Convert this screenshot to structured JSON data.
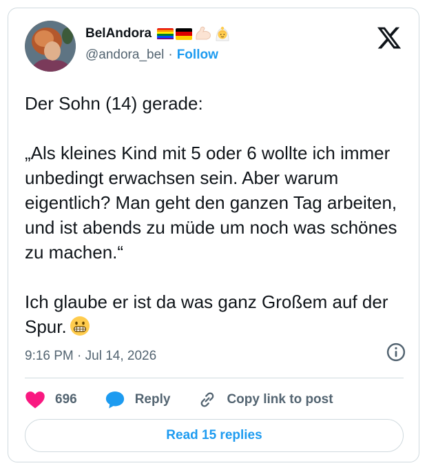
{
  "author": {
    "display_name": "BelAndora",
    "handle": "@andora_bel",
    "follow_label": "Follow",
    "separator": "·",
    "badges": [
      "rainbow-flag",
      "germany-flag",
      "flexed-biceps",
      "person-with-veil"
    ]
  },
  "tweet": {
    "paragraphs": [
      "Der Sohn (14) gerade:",
      "„Als kleines Kind mit 5 oder 6 wollte ich immer unbedingt erwachsen sein. Aber warum eigentlich? Man geht den ganzen Tag arbeiten, und ist abends zu müde um noch was schönes zu machen.“",
      "Ich glaube er ist da was ganz Großem auf der Spur."
    ],
    "trailing_emoji": "grimacing-face"
  },
  "meta": {
    "timestamp": "9:16 PM · Jul 14, 2026"
  },
  "actions": {
    "likes": "696",
    "reply_label": "Reply",
    "copy_label": "Copy link to post"
  },
  "footer": {
    "read_replies_label": "Read 15 replies"
  },
  "colors": {
    "accent": "#1d9bf0",
    "like": "#f91880",
    "text": "#0f1419",
    "muted": "#536471",
    "border": "#cfd9de"
  }
}
